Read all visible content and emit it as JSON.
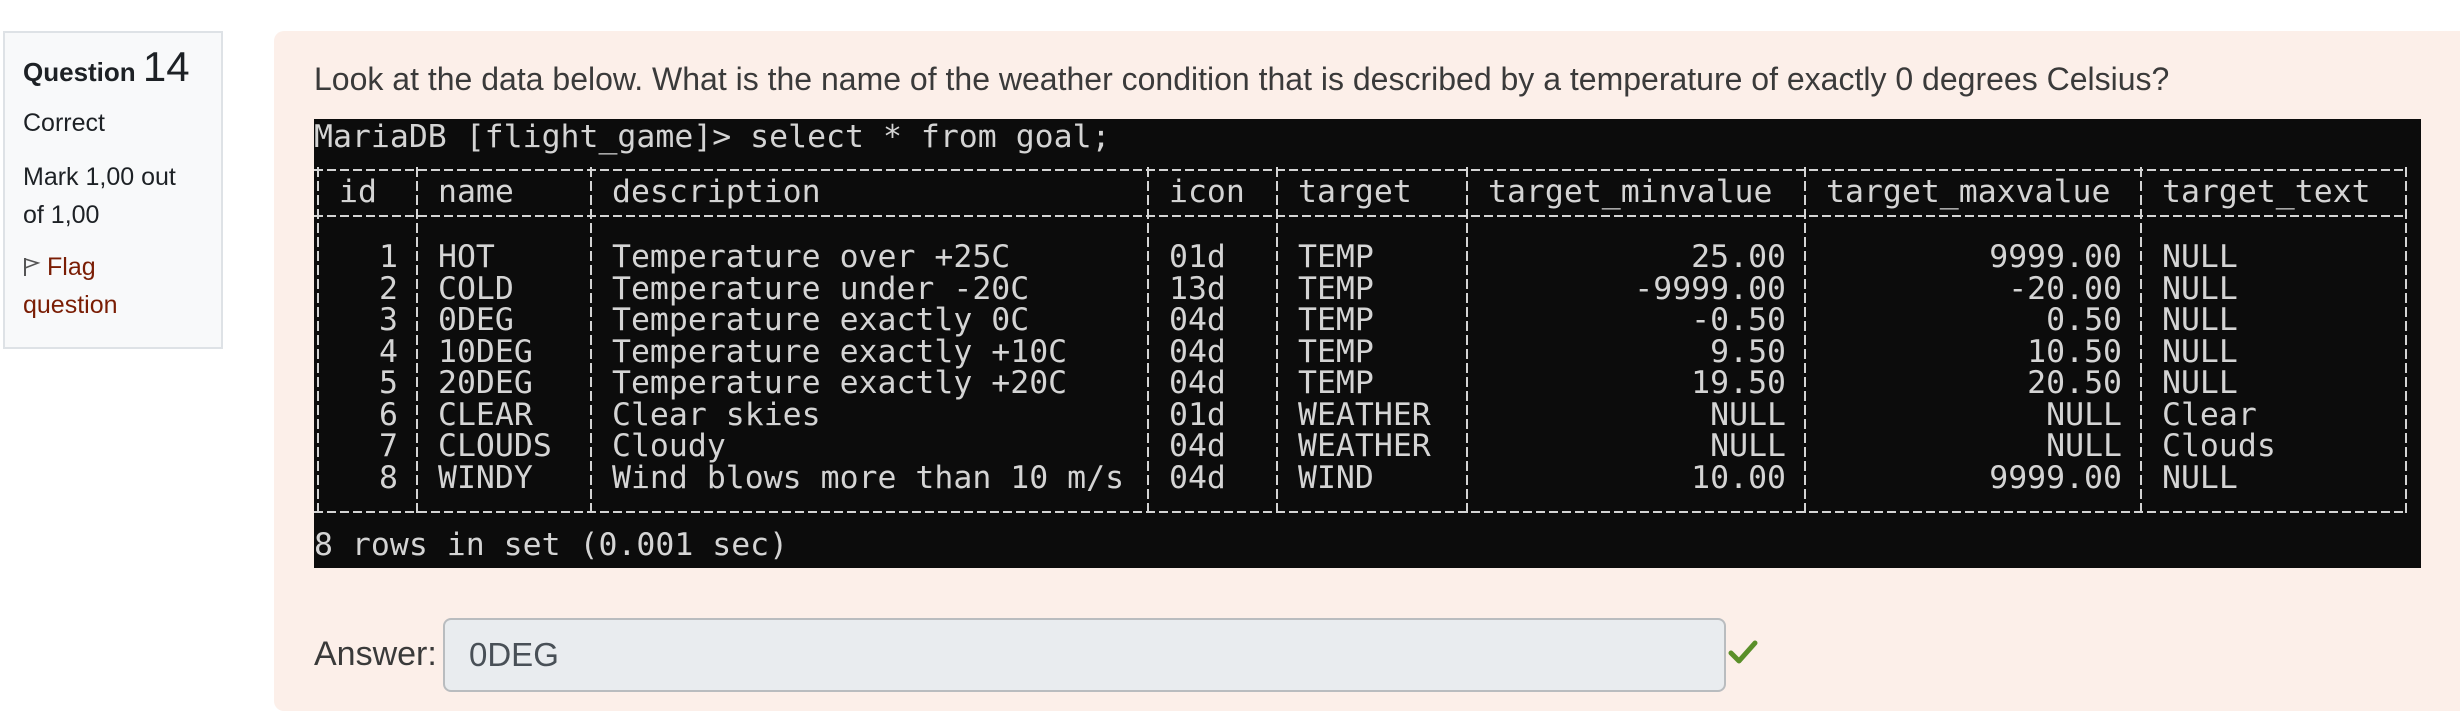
{
  "info": {
    "question_label": "Question",
    "question_number": "14",
    "state": "Correct",
    "grade_line1": "Mark 1,00 out",
    "grade_line2": "of 1,00",
    "flag_line1": "Flag",
    "flag_line2": "question"
  },
  "question_text": "Look at the data below. What is the name of the weather condition that is described by a temperature of exactly 0 degrees Celsius?",
  "terminal": {
    "command": "MariaDB [flight_game]> select * from goal;",
    "footer": "8 rows in set (0.001 sec)",
    "columns": [
      "id",
      "name",
      "description",
      "icon",
      "target",
      "target_minvalue",
      "target_maxvalue",
      "target_text"
    ],
    "rows": [
      [
        "1",
        "HOT",
        "Temperature over +25C",
        "01d",
        "TEMP",
        "25.00",
        "9999.00",
        "NULL"
      ],
      [
        "2",
        "COLD",
        "Temperature under -20C",
        "13d",
        "TEMP",
        "-9999.00",
        "-20.00",
        "NULL"
      ],
      [
        "3",
        "0DEG",
        "Temperature exactly 0C",
        "04d",
        "TEMP",
        "-0.50",
        "0.50",
        "NULL"
      ],
      [
        "4",
        "10DEG",
        "Temperature exactly +10C",
        "04d",
        "TEMP",
        "9.50",
        "10.50",
        "NULL"
      ],
      [
        "5",
        "20DEG",
        "Temperature exactly +20C",
        "04d",
        "TEMP",
        "19.50",
        "20.50",
        "NULL"
      ],
      [
        "6",
        "CLEAR",
        "Clear skies",
        "01d",
        "WEATHER",
        "NULL",
        "NULL",
        "Clear"
      ],
      [
        "7",
        "CLOUDS",
        "Cloudy",
        "04d",
        "WEATHER",
        "NULL",
        "NULL",
        "Clouds"
      ],
      [
        "8",
        "WINDY",
        "Wind blows more than 10 m/s",
        "04d",
        "WIND",
        "10.00",
        "9999.00",
        "NULL"
      ]
    ]
  },
  "answer": {
    "label": "Answer:",
    "value": "0DEG",
    "status_icon": "check-icon",
    "status_color": "#5a8f29"
  },
  "colors": {
    "formulation_bg": "#fcefe9",
    "terminal_bg": "#0c0c0c",
    "terminal_fg": "#d4d4d4",
    "flag_link": "#7a1d04"
  }
}
